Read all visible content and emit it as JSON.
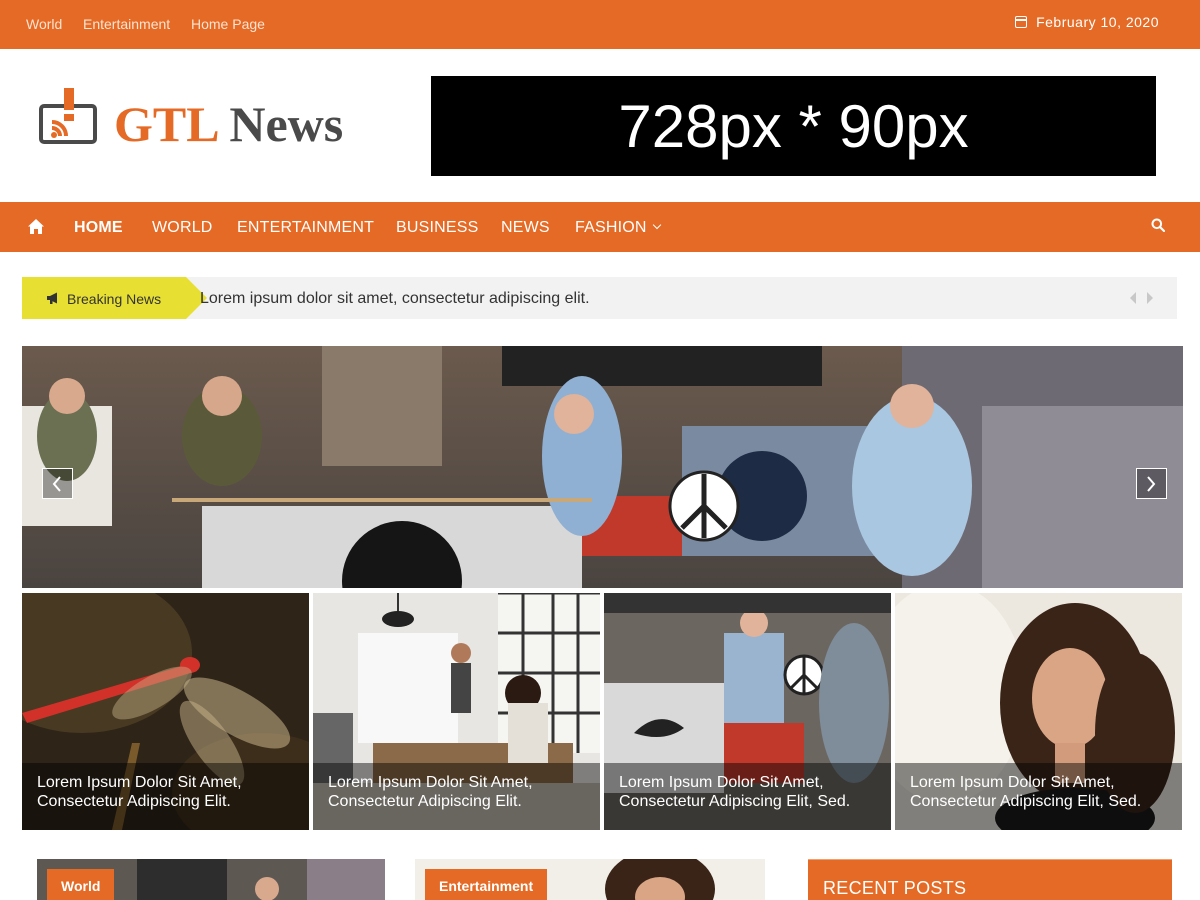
{
  "topbar": {
    "links": [
      "World",
      "Entertainment",
      "Home Page"
    ],
    "date": "February 10, 2020",
    "calendar_icon": "calendar-icon"
  },
  "header": {
    "logo_part1": "GTL",
    "logo_part2": "News",
    "ad_text": "728px * 90px"
  },
  "nav": {
    "home_icon": "home-icon",
    "items": [
      "HOME",
      "WORLD",
      "ENTERTAINMENT",
      "BUSINESS",
      "NEWS",
      "FASHION"
    ],
    "active": "HOME",
    "search_icon": "search-icon"
  },
  "breaking": {
    "label": "Breaking News",
    "text": "Lorem ipsum dolor sit amet, consectetur adipiscing elit."
  },
  "grid": [
    {
      "caption": "Lorem Ipsum Dolor Sit Amet, Consectetur Adipiscing Elit."
    },
    {
      "caption": "Lorem Ipsum Dolor Sit Amet, Consectetur Adipiscing Elit."
    },
    {
      "caption": "Lorem Ipsum Dolor Sit Amet, Consectetur Adipiscing Elit, Sed."
    },
    {
      "caption": "Lorem Ipsum Dolor Sit Amet, Consectetur Adipiscing Elit, Sed."
    }
  ],
  "bottom": {
    "card1_category": "World",
    "card2_category": "Entertainment",
    "recent_title": "RECENT POSTS"
  },
  "colors": {
    "brand": "#e46a25",
    "breaking": "#e7e033"
  }
}
